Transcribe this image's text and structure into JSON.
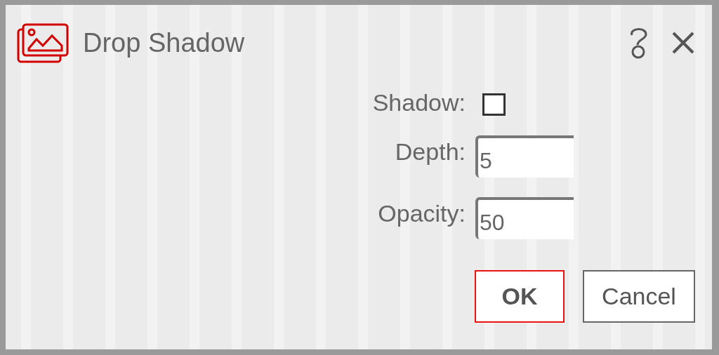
{
  "window": {
    "title": "Drop Shadow"
  },
  "fields": [
    {
      "kind": "checkbox",
      "label": "Shadow:",
      "checked": false
    },
    {
      "kind": "number",
      "label": "Depth:",
      "value": "5"
    },
    {
      "kind": "number",
      "label": "Opacity:",
      "value": "50"
    }
  ],
  "buttons": [
    {
      "label": "OK",
      "kind": "primary"
    },
    {
      "label": "Cancel",
      "kind": "secondary"
    }
  ]
}
